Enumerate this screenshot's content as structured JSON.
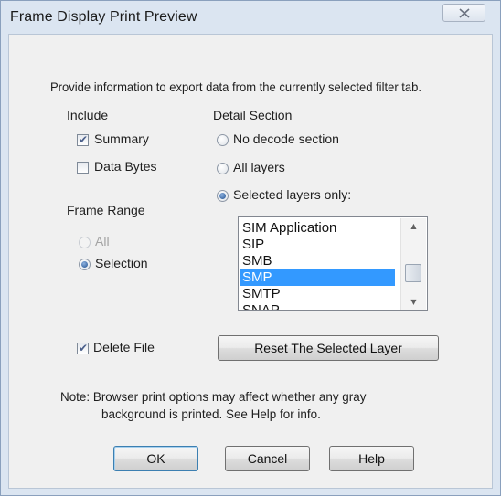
{
  "window": {
    "title": "Frame Display Print Preview"
  },
  "intro_text": "Provide information to export data from the currently selected filter tab.",
  "include": {
    "heading": "Include",
    "summary_label": "Summary",
    "summary_checked": true,
    "data_bytes_label": "Data Bytes",
    "data_bytes_checked": false
  },
  "frame_range": {
    "heading": "Frame Range",
    "all_label": "All",
    "selection_label": "Selection",
    "selected": "Selection"
  },
  "detail_section": {
    "heading": "Detail Section",
    "options": [
      "No decode section",
      "All layers",
      "Selected layers only:"
    ],
    "selected": "Selected layers only:"
  },
  "layers_list": {
    "items": [
      "SIM Application",
      "SIP",
      "SMB",
      "SMP",
      "SMTP",
      "SNAP"
    ],
    "selected": "SMP"
  },
  "delete_file": {
    "label": "Delete File",
    "checked": true
  },
  "reset_button_label": "Reset The Selected Layer",
  "note": {
    "line1": "Note:  Browser print options may affect whether any gray",
    "line2": "background is printed.  See Help for info."
  },
  "buttons": {
    "ok": "OK",
    "cancel": "Cancel",
    "help": "Help"
  },
  "icons": {
    "close": "close-icon",
    "check": "checkmark-icon",
    "scroll_up": "chevron-up-icon",
    "scroll_down": "chevron-down-icon"
  },
  "colors": {
    "frame": "#dbe5f1",
    "selection_highlight": "#3399ff"
  }
}
